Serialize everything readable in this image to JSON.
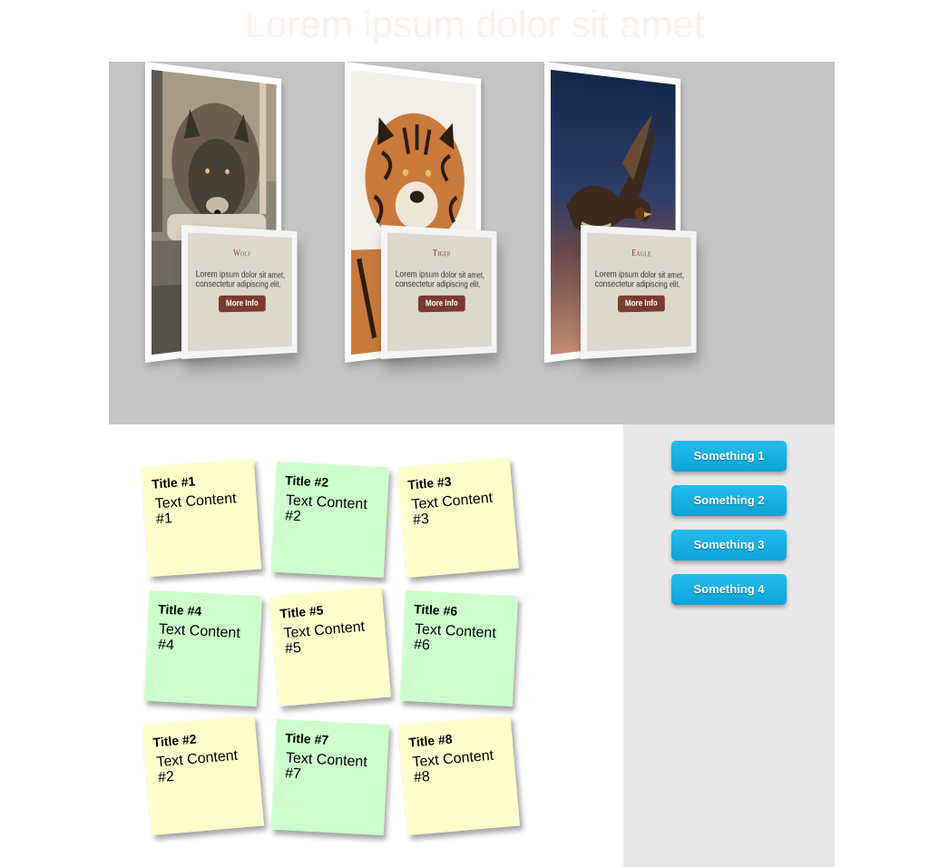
{
  "page": {
    "title": "Lorem ipsum dolor sit amet"
  },
  "gallery": {
    "cards": [
      {
        "name": "Wolf",
        "text": "Lorem ipsum dolor sit amet, consectetur adipiscing elit.",
        "button": "More Info",
        "photo_colors": [
          "#6b5d4f",
          "#3f352c",
          "#b6a896"
        ]
      },
      {
        "name": "Tiger",
        "text": "Lorem ipsum dolor sit amet, consectetur adipiscing elit.",
        "button": "More Info",
        "photo_colors": [
          "#c97a3a",
          "#2a1d14",
          "#f2efe9"
        ]
      },
      {
        "name": "Eagle",
        "text": "Lorem ipsum dolor sit amet, consectetur adipiscing elit.",
        "button": "More Info",
        "photo_colors": [
          "#1a2b4f",
          "#6b4a4a",
          "#c08b70"
        ]
      }
    ]
  },
  "sidebar": {
    "buttons": [
      "Something 1",
      "Something 2",
      "Something 3",
      "Something 4"
    ]
  },
  "notes": [
    {
      "title": "Title #1",
      "text": "Text Content #1",
      "color": "yellow"
    },
    {
      "title": "Title #2",
      "text": "Text Content #2",
      "color": "green"
    },
    {
      "title": "Title #3",
      "text": "Text Content #3",
      "color": "yellow"
    },
    {
      "title": "Title #4",
      "text": "Text Content #4",
      "color": "green"
    },
    {
      "title": "Title #5",
      "text": "Text Content #5",
      "color": "yellow"
    },
    {
      "title": "Title #6",
      "text": "Text Content #6",
      "color": "green"
    },
    {
      "title": "Title #2",
      "text": "Text Content #2",
      "color": "yellow"
    },
    {
      "title": "Title #7",
      "text": "Text Content #7",
      "color": "green"
    },
    {
      "title": "Title #8",
      "text": "Text Content #8",
      "color": "yellow"
    }
  ]
}
